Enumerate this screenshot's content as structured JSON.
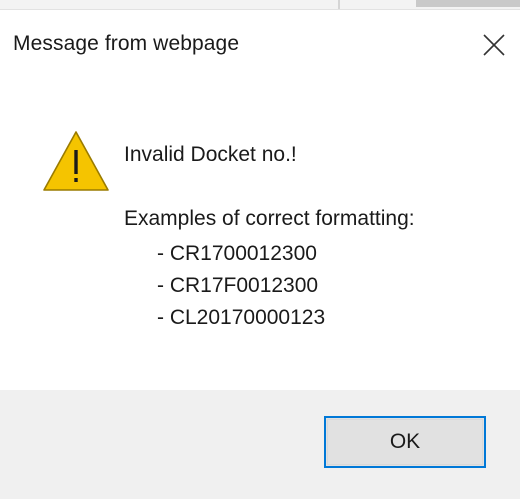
{
  "window": {
    "title": "Message from webpage",
    "close_icon": "close-x-icon"
  },
  "message": {
    "icon": "warning-triangle-icon",
    "icon_color": "#f5c400",
    "main": "Invalid Docket no.!",
    "subheading": "Examples of correct formatting:",
    "examples": [
      "- CR1700012300",
      "- CR17F0012300",
      "- CL20170000123"
    ]
  },
  "footer": {
    "ok_label": "OK",
    "accent_color": "#0078d7"
  }
}
